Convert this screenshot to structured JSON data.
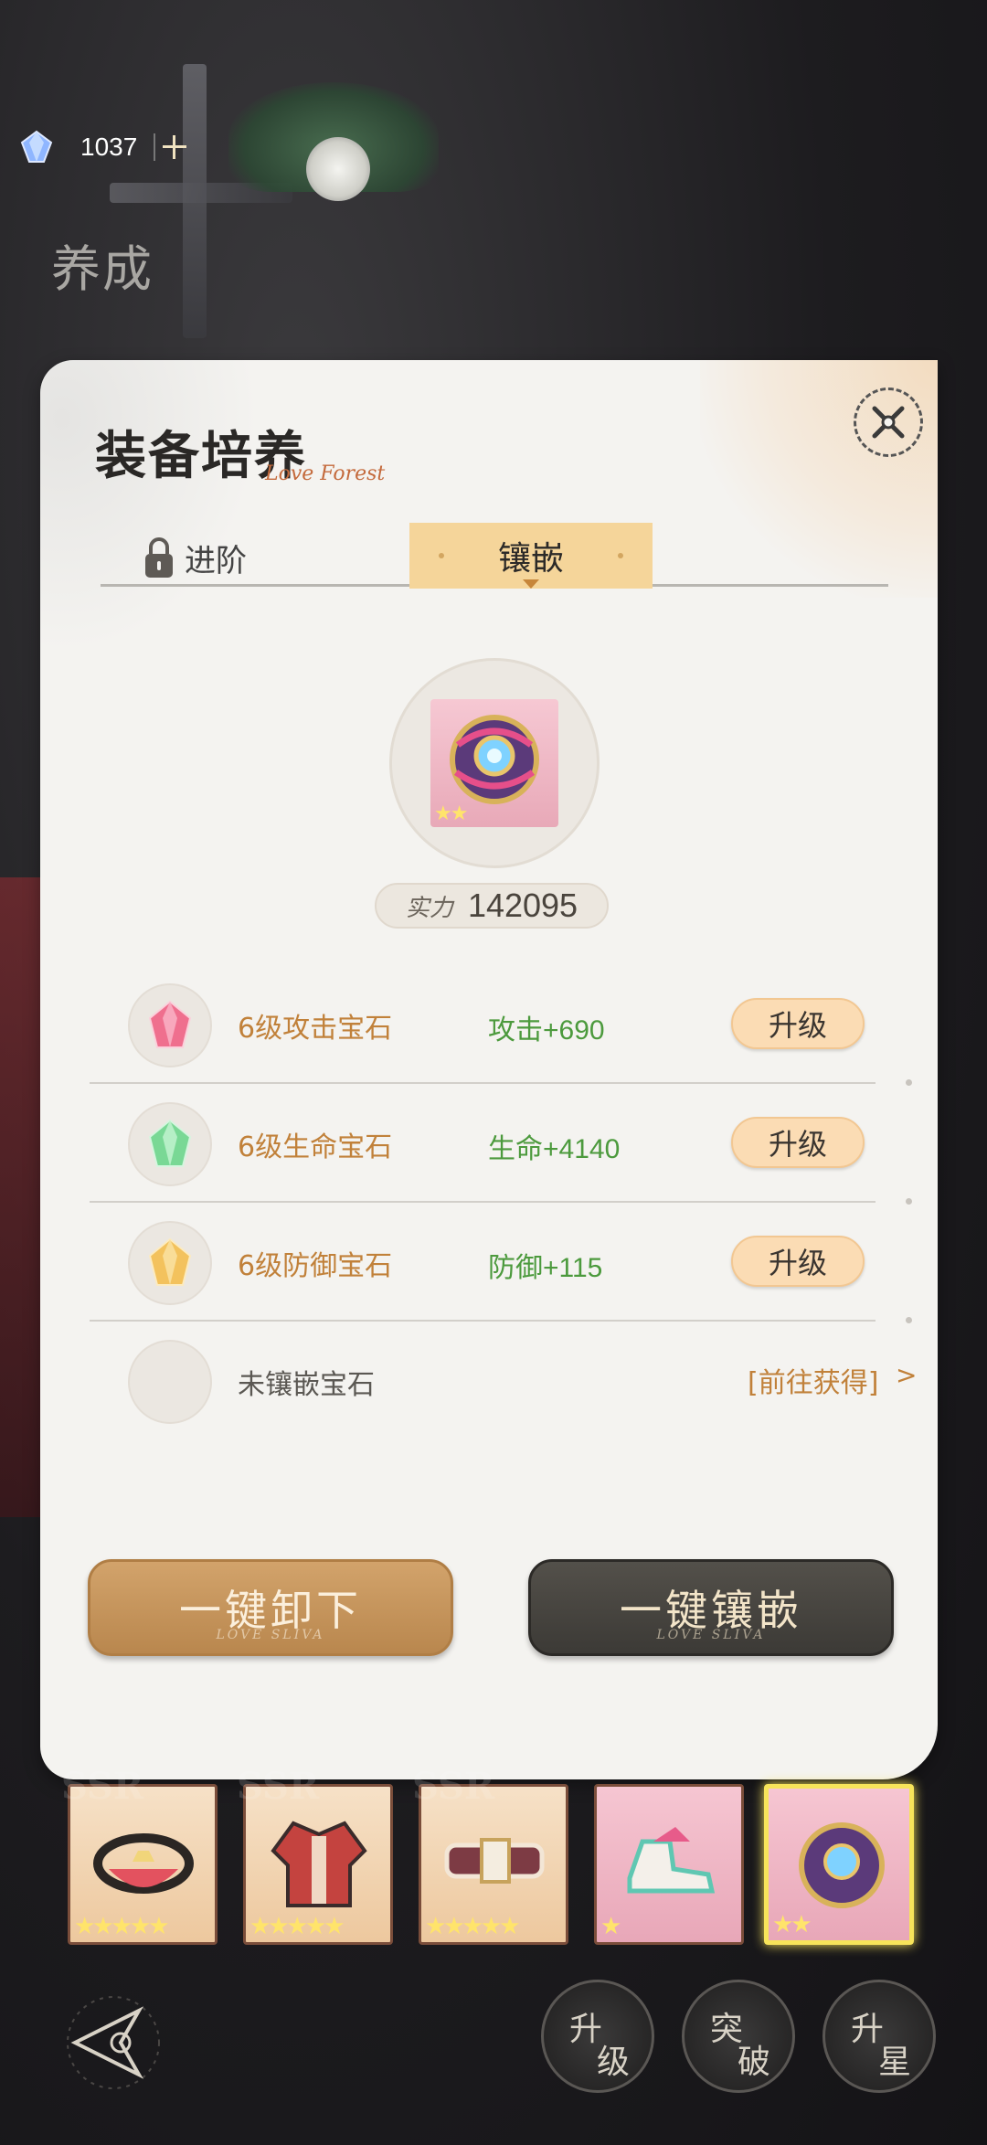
{
  "topbar": {
    "currency_value": "1037"
  },
  "screen_title": "养成",
  "panel": {
    "title": "装备培养",
    "subtitle": "Love Forest",
    "tabs": [
      {
        "label": "进阶",
        "locked": true
      },
      {
        "label": "镶嵌",
        "active": true
      }
    ],
    "equipment": {
      "stars": "★★"
    },
    "power": {
      "label": "实力",
      "value": "142095"
    },
    "gems": [
      {
        "name": "6级攻击宝石",
        "stat": "攻击+690",
        "action": "升级",
        "color": "#e8607a"
      },
      {
        "name": "6级生命宝石",
        "stat": "生命+4140",
        "action": "升级",
        "color": "#6fcf88"
      },
      {
        "name": "6级防御宝石",
        "stat": "防御+115",
        "action": "升级",
        "color": "#f0b850"
      }
    ],
    "empty_slot": {
      "name": "未镶嵌宝石",
      "link": "[前往获得]",
      "arrow": ">"
    },
    "buttons": {
      "unload": "一键卸下",
      "inlay": "一键镶嵌",
      "sub_text": "LOVE SLIVA"
    }
  },
  "equipment_strip": [
    {
      "stars": "★★★★★",
      "mark": "SSR"
    },
    {
      "stars": "★★★★★",
      "mark": "SSR"
    },
    {
      "stars": "★★★★★",
      "mark": "SSR"
    },
    {
      "stars": "★"
    },
    {
      "stars": "★★",
      "selected": true
    }
  ],
  "nav": {
    "upgrade": [
      "升",
      "级"
    ],
    "breakthrough": [
      "突",
      "破"
    ],
    "star_up": [
      "升",
      "星"
    ]
  },
  "colors": {
    "accent": "#f5d59a",
    "gold": "#c1813a",
    "stat_green": "#4c9a3d"
  }
}
